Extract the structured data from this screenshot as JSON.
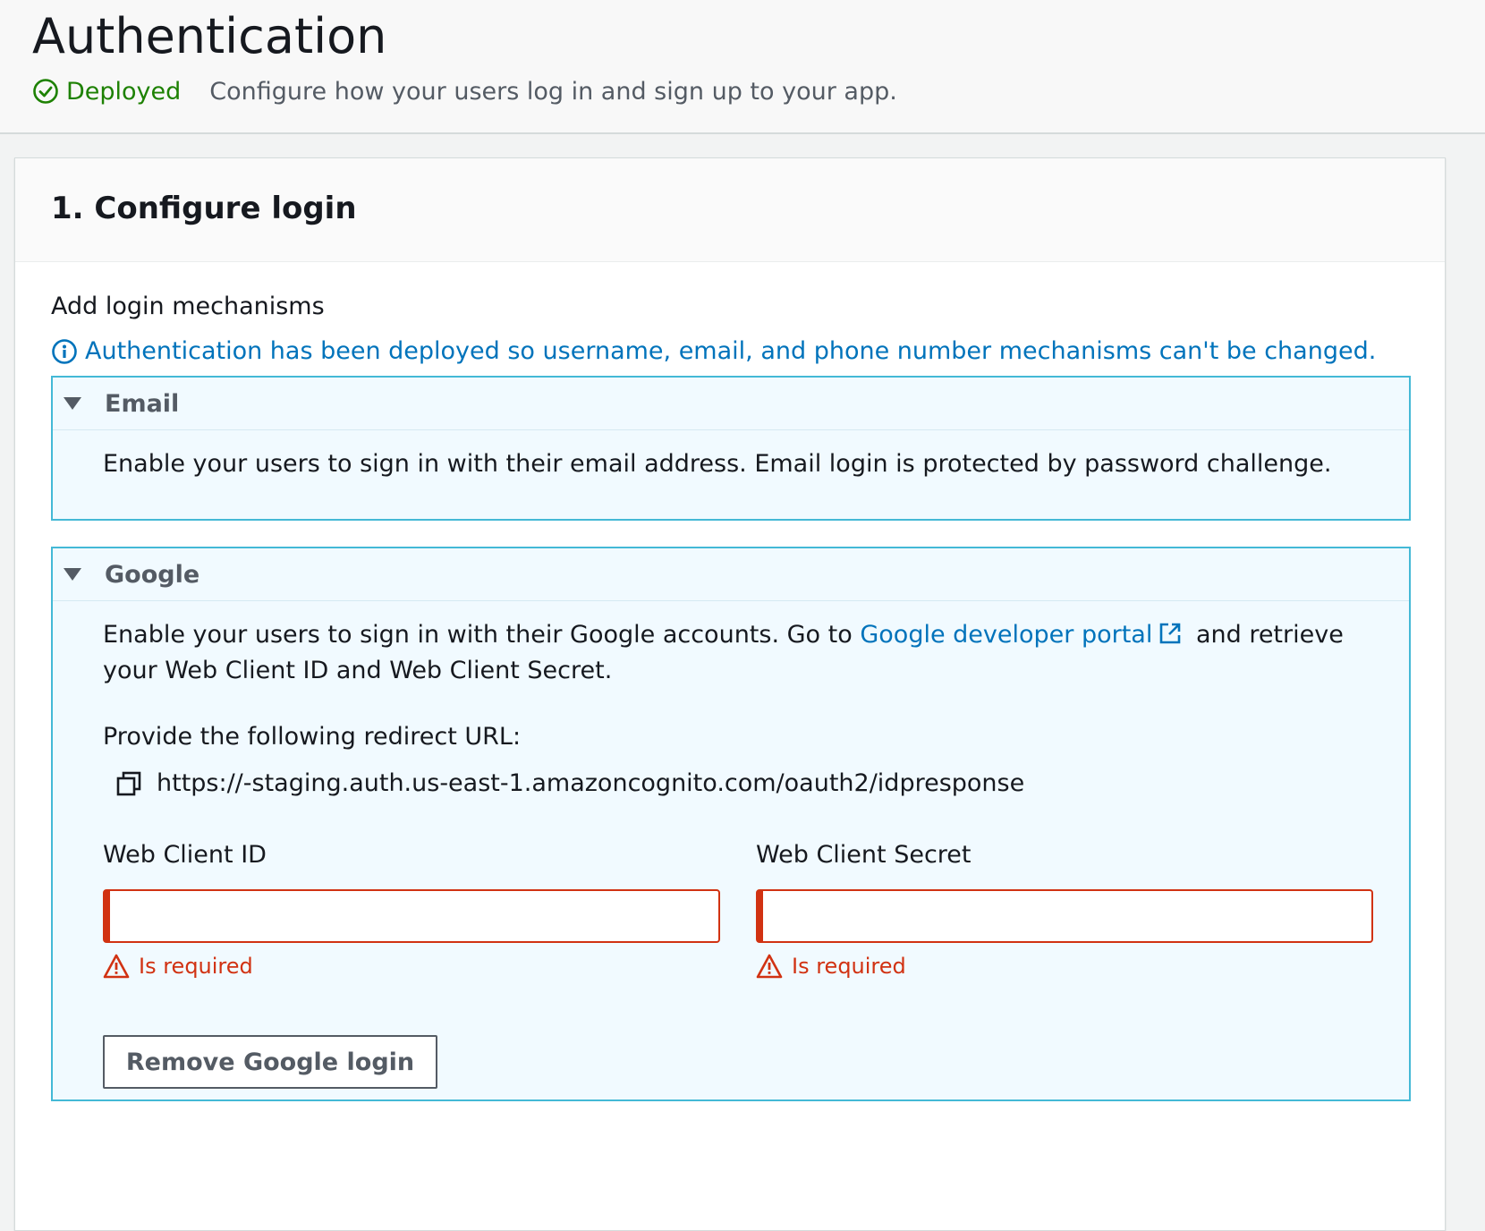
{
  "header": {
    "title": "Authentication",
    "status": "Deployed",
    "description": "Configure how your users log in and sign up to your app."
  },
  "panel": {
    "title": "1. Configure login",
    "section_label": "Add login mechanisms",
    "info_message": "Authentication has been deployed so username, email, and phone number mechanisms can't be changed.",
    "email": {
      "title": "Email",
      "text": "Enable your users to sign in with their email address. Email login is protected by password challenge."
    },
    "google": {
      "title": "Google",
      "intro_before_link": "Enable your users to sign in with their Google accounts. Go to",
      "link_text": "Google developer portal",
      "intro_after_link": "and retrieve your Web Client ID and Web Client Secret.",
      "redirect_label": "Provide the following redirect URL:",
      "redirect_url": "https://-staging.auth.us-east-1.amazoncognito.com/oauth2/idpresponse",
      "client_id_label": "Web Client ID",
      "client_id_value": "",
      "client_secret_label": "Web Client Secret",
      "client_secret_value": "",
      "error_text": "Is required",
      "remove_button": "Remove Google login"
    }
  },
  "colors": {
    "success": "#1d8102",
    "link": "#0073bb",
    "error": "#d13212",
    "expander_border": "#44b9d6",
    "expander_bg": "#f1faff"
  }
}
